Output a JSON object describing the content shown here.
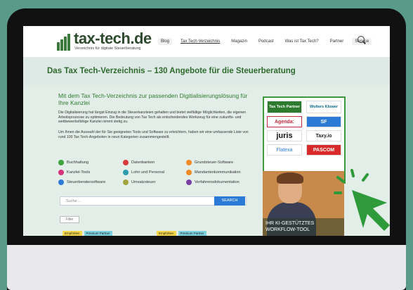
{
  "site": {
    "logo_text": "tax-tech.de",
    "tagline": "Verzeichnis für digitale Steuerberatung"
  },
  "nav": [
    "Blog",
    "Tax Tech-Verzeichnis",
    "Magazin",
    "Podcast",
    "Was ist Tax Tech?",
    "Partner",
    "Service"
  ],
  "page_title": "Das Tax Tech-Verzeichnis – 130 Angebote für die Steuerberatung",
  "intro": {
    "heading": "Mit dem Tax Tech-Verzeichnis zur passenden Digitialisierungslösung für Ihre Kanzlei",
    "p1": "Die Digitalisierung hat längst Einzug in die Steuerkanzleien gehalten und bietet vielfältige Möglichkeiten, die eigenen Arbeitsprozesse zu optimieren. Die Bedeutung von Tax Tech als entscheidendes Werkzeug für eine zukunfts- und wettbewerbsfähige Kanzlei nimmt stetig zu.",
    "p2": "Um Ihnen die Auswahl der für Sie geeigneten Tools und Software zu erleichtern, haben wir eine umfassende Liste von rund 100 Tax Tech-Angeboten in neun Kategorien zusammengestellt."
  },
  "categories": [
    {
      "label": "Buchhaltung",
      "color": "#3fa33f"
    },
    {
      "label": "Datenbanken",
      "color": "#d83a3a"
    },
    {
      "label": "Grundsteuer-Software",
      "color": "#f08a24"
    },
    {
      "label": "Kanzlei-Tools",
      "color": "#d8337a"
    },
    {
      "label": "Lohn und Personal",
      "color": "#2b9bb0"
    },
    {
      "label": "Mandantenkommunikation",
      "color": "#f08a24"
    },
    {
      "label": "Steuerberatersoftware",
      "color": "#2b7bd6"
    },
    {
      "label": "Umsatzsteuer",
      "color": "#a3a33f"
    },
    {
      "label": "Verfahrensdokumentation",
      "color": "#7a3fa3"
    }
  ],
  "search": {
    "placeholder": "Suche ...",
    "button": "SEARCH"
  },
  "filter_label": "Filter",
  "tags": [
    "Empfohlen",
    "Premium Partner"
  ],
  "ads": [
    "Tax Tech Partner",
    "Wolters Kluwer",
    "Agenda:",
    "SF",
    "juris",
    "Taxy.io",
    "Flatexa",
    "PASCOM"
  ],
  "promo": {
    "line1": "IHR KI-GESTÜTZTES",
    "line2": "WORKFLOW-TOOL"
  },
  "colors": {
    "accent_green": "#3c9a3c",
    "background": "#5a9a88"
  }
}
